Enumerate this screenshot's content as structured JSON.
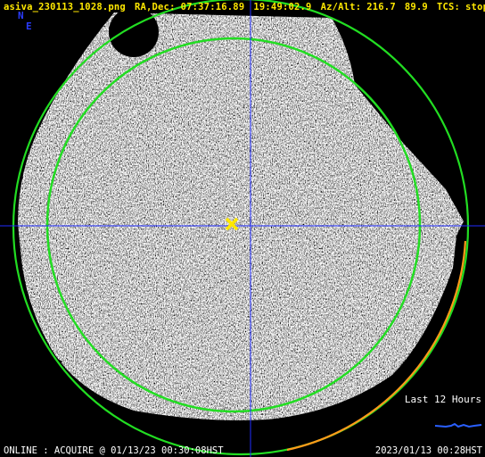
{
  "header": {
    "filename": "asiva_230113_1028.png",
    "radec_label": "RA,Dec:",
    "ra": "07:37:16.89",
    "dec": "19:49:02.9",
    "azalt_label": "Az/Alt:",
    "az": "216.7",
    "alt": "89.9",
    "tcs_label": "TCS:",
    "tcs_value": "stop"
  },
  "compass": {
    "north": "N",
    "east": "E"
  },
  "legend": {
    "label": "Last 12 Hours"
  },
  "status": {
    "left": "ONLINE : ACQUIRE @ 01/13/23 00:30:08HST",
    "right": "2023/01/13 00:28HST"
  },
  "colors": {
    "header_text": "#ffe800",
    "crosshair": "#1f2bff",
    "fov_circle": "#22dd22",
    "horizon_circle": "#22dd22",
    "horizon_arc": "#ff9a1a",
    "target_marker": "#ffe800",
    "history_trace": "#2a60ff"
  },
  "icons": {
    "target": "x-marker-icon",
    "compass": "compass-icon"
  }
}
